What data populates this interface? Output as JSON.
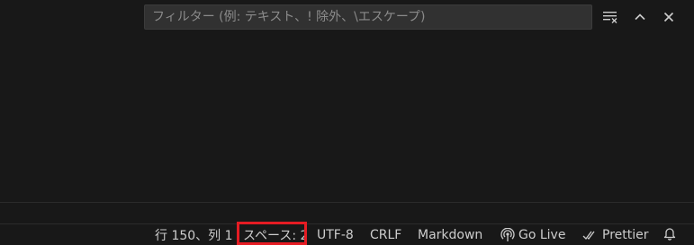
{
  "filter": {
    "placeholder": "フィルター (例: テキスト、! 除外、\\エスケープ)",
    "value": ""
  },
  "toolbar": {
    "icons": [
      "clear-filter-icon",
      "chevron-up-icon",
      "close-icon"
    ]
  },
  "statusbar": {
    "cursor_position": "行 150、列 1",
    "indentation": "スペース: 2",
    "encoding": "UTF-8",
    "line_ending": "CRLF",
    "language_mode": "Markdown",
    "go_live": "Go Live",
    "prettier": "Prettier",
    "icons": [
      "broadcast-icon",
      "double-check-icon",
      "bell-icon"
    ]
  },
  "colors": {
    "background": "#181818",
    "input_background": "#313131",
    "text": "#cccccc",
    "highlight": "#e51c23"
  }
}
